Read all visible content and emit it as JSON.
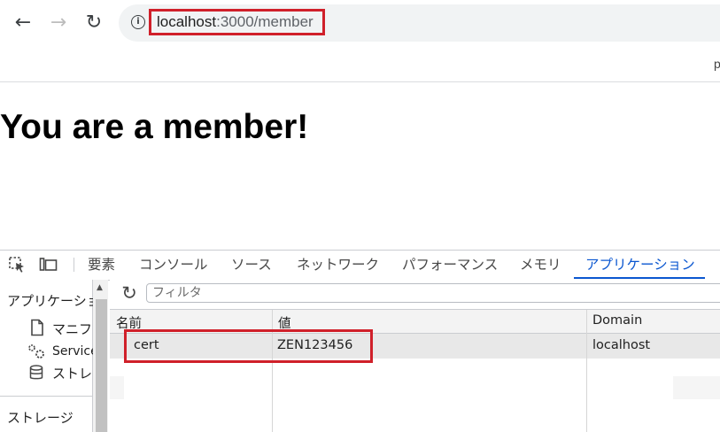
{
  "browser": {
    "back_icon": "←",
    "forward_icon": "→",
    "reload_icon": "↻",
    "info_icon": "i",
    "url_host": "localhost",
    "url_path": ":3000/member",
    "edge_text": "p"
  },
  "page": {
    "heading": "You are a member!"
  },
  "devtools": {
    "tabs": [
      "要素",
      "コンソール",
      "ソース",
      "ネットワーク",
      "パフォーマンス",
      "メモリ",
      "アプリケーション"
    ],
    "active_tab": "アプリケーション",
    "sidebar": {
      "section_application": "アプリケーショ",
      "items": [
        "マニフ",
        "Service",
        "ストレ"
      ],
      "section_storage": "ストレージ"
    },
    "filter": {
      "placeholder": "フィルタ"
    },
    "table": {
      "headers": [
        "名前",
        "値",
        "Domain"
      ],
      "rows": [
        {
          "name": "cert",
          "value": "ZEN123456",
          "domain": "localhost"
        }
      ]
    }
  },
  "colors": {
    "highlight": "#d0202a",
    "active_tab": "#0b57d0"
  }
}
